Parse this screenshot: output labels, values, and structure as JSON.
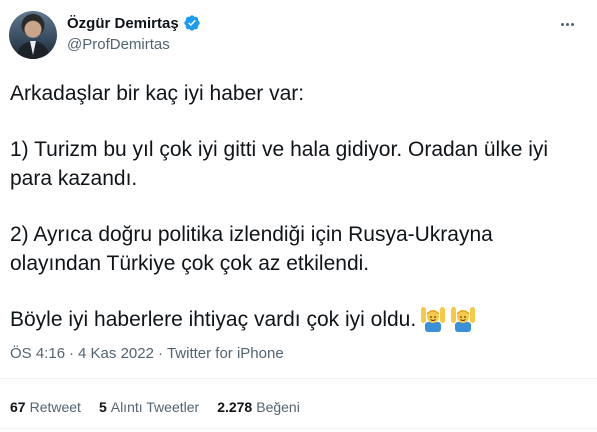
{
  "author": {
    "name": "Özgür Demirtaş",
    "handle": "@ProfDemirtas",
    "verified": true,
    "accent": "#1d9bf0"
  },
  "tweet": {
    "paragraphs": [
      "Arkadaşlar bir kaç iyi haber var:",
      "1) Turizm bu yıl çok iyi gitti ve hala gidiyor. Oradan ülke iyi para kazandı.",
      "2) Ayrıca doğru politika izlendiği için Rusya-Ukrayna olayından Türkiye çok çok az etkilendi.",
      "Böyle iyi haberlere ihtiyaç vardı çok iyi oldu."
    ],
    "emojis": [
      "raising-hands-person-icon",
      "raising-hands-person-icon"
    ]
  },
  "meta": {
    "time": "ÖS 4:16",
    "sep1": "·",
    "date": "4 Kas 2022",
    "sep2": "·",
    "source": "Twitter for iPhone"
  },
  "stats": {
    "retweets": {
      "count": "67",
      "label": "Retweet"
    },
    "quotes": {
      "count": "5",
      "label": "Alıntı Tweetler"
    },
    "likes": {
      "count": "2.278",
      "label": "Beğeni"
    }
  }
}
